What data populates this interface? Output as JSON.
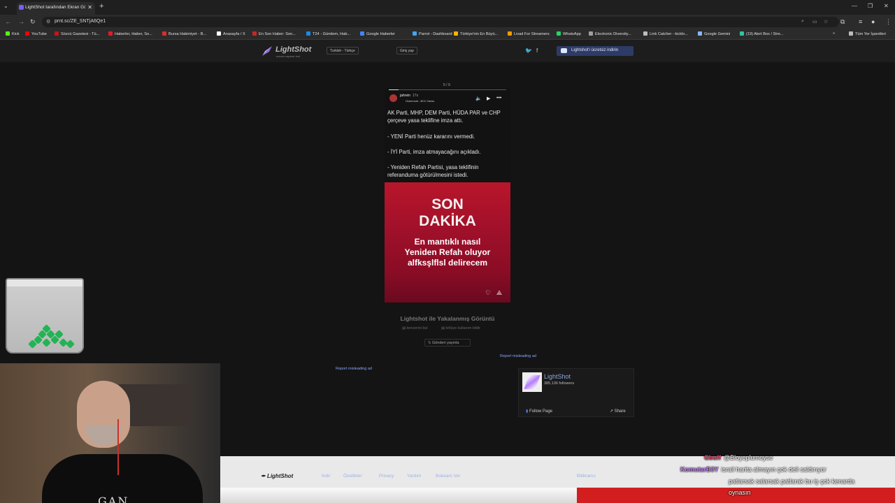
{
  "browser": {
    "tab_title": "LightShot tarafından Ekran Görü...",
    "url": "prnt.sc/ZE_SNTjA6Qe1",
    "bookmarks": [
      {
        "label": "Kick",
        "color": "#53fc18"
      },
      {
        "label": "YouTube",
        "color": "#ff0000"
      },
      {
        "label": "Sözcü Gazetesi - Tü...",
        "color": "#c4161c"
      },
      {
        "label": "Haberler, Haber, So...",
        "color": "#e21b2b"
      },
      {
        "label": "Bursa Hakimiyet - B...",
        "color": "#d32f2f"
      },
      {
        "label": "Anasayfa / X",
        "color": "#ffffff"
      },
      {
        "label": "En Son Haber: Son...",
        "color": "#c62828"
      },
      {
        "label": "T24 - Gündem, Hab...",
        "color": "#1e88e5"
      },
      {
        "label": "Google Haberler",
        "color": "#4285f4"
      },
      {
        "label": "Parrot - Dashboard",
        "color": "#42a5f5"
      },
      {
        "label": "Türkiye'nin En Büyü...",
        "color": "#ffb300"
      },
      {
        "label": "Livad For Streamers",
        "color": "#ff9800"
      },
      {
        "label": "WhatsApp",
        "color": "#25d366"
      },
      {
        "label": "Electronic Diversity...",
        "color": "#9e9e9e"
      },
      {
        "label": "Link Catcher - kicklo...",
        "color": "#bdbdbd"
      },
      {
        "label": "Google Gemini",
        "color": "#8ab4f8"
      },
      {
        "label": "(19) Alert Box / Stre...",
        "color": "#31c3a2"
      }
    ],
    "all_bookmarks": "Tüm Yer İşaretleri"
  },
  "site": {
    "logo": "LightShot",
    "logo_sub": "screen capture tool",
    "language": "Turkish - Türkçe",
    "login": "Giriş yap",
    "download": "Lightshot'ı ücretsiz indirin"
  },
  "story": {
    "counter": "5 / 9",
    "user": "jahrein",
    "time": "17s",
    "source": "Ockemold - BCC News",
    "lines": [
      "AK Parti, MHP, DEM Parti, HÜDA PAR ve CHP",
      "çerçeve yasa teklifine imza attı.",
      "- YENİ Parti henüz kararını vermedi.",
      "- İYİ Parti, imza atmayacağını açıkladı.",
      "- Yeniden Refah Partisi, yasa teklifinin",
      "referanduma götürülmesini istedi."
    ],
    "headline_1": "SON",
    "headline_2": "DAKİKA",
    "caption_1": "En mantıklı nasıl",
    "caption_2": "Yeniden Refah oluyor",
    "caption_3": "alfksşlflsl delirecem"
  },
  "page": {
    "captured_title": "Lightshot ile Yakalanmış Görüntü",
    "link_like": "benzerini bul",
    "link_report": "kötüye kullanım bildir",
    "tweet": "Gönderi yayınla",
    "report_ad_1": "Report misleading ad",
    "report_ad_2": "Report misleading ad"
  },
  "facebook": {
    "name": "LightShot",
    "followers": "385,136 followers",
    "follow": "Follow Page",
    "share": "Share"
  },
  "footer": {
    "logo": "LightShot",
    "links": [
      "İndir",
      "Özellikler",
      "Privacy",
      "Yardım",
      "Bokeam Ver"
    ],
    "extra": "Bilibrams"
  },
  "chat": [
    {
      "user": "Gbuff",
      "user_color": "#ff3b6b",
      "message": "@Bloyeplumeyse"
    },
    {
      "user": "KomutarB3Y",
      "user_color": "#c77dff",
      "message": "israil harita almayın çok deli saldırıyor"
    },
    {
      "user": "",
      "user_color": "#ffffff",
      "message": "patlarsak salarsak patlarak bu iş çok kenarda"
    },
    {
      "user": "",
      "user_color": "#ffffff",
      "message": "oynasın"
    }
  ]
}
